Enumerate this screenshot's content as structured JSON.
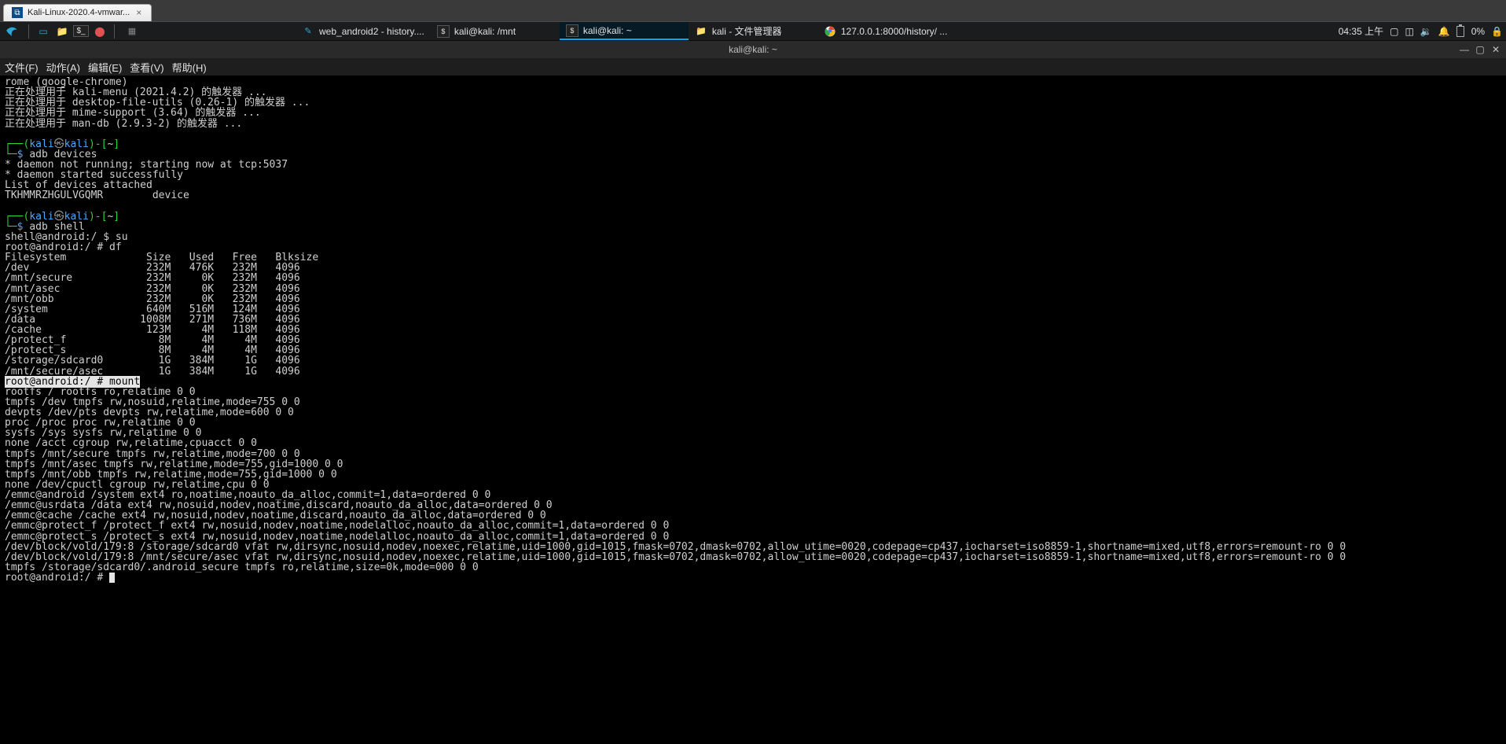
{
  "host_tab": {
    "label": "Kali-Linux-2020.4-vmwar...",
    "close": "×"
  },
  "panel": {
    "tasks": [
      {
        "icon": "☵",
        "label": ""
      },
      {
        "icon": "🗔",
        "label": "web_android2 - history...."
      },
      {
        "icon": "$",
        "label": "kali@kali: /mnt"
      },
      {
        "icon": "$",
        "label": "kali@kali: ~",
        "active": true
      },
      {
        "icon": "📁",
        "label": "kali - 文件管理器"
      },
      {
        "icon": "◎",
        "label": "127.0.0.1:8000/history/ ..."
      }
    ],
    "clock": "04:35 上午",
    "battery": "0%"
  },
  "terminal": {
    "title": "kali@kali: ~",
    "menus": [
      "文件(F)",
      "动作(A)",
      "编辑(E)",
      "查看(V)",
      "帮助(H)"
    ]
  },
  "term_output": {
    "pre1": "rome (google-chrome)\n正在处理用于 kali-menu (2021.4.2) 的触发器 ...\n正在处理用于 desktop-file-utils (0.26-1) 的触发器 ...\n正在处理用于 mime-support (3.64) 的触发器 ...\n正在处理用于 man-db (2.9.3-2) 的触发器 ...",
    "prompt1_cmd": "adb devices",
    "out1": "* daemon not running; starting now at tcp:5037\n* daemon started successfully\nList of devices attached\nTKHMMRZHGULVGQMR\tdevice\n",
    "prompt2_cmd": "adb shell",
    "out2a": "shell@android:/ $ su\nroot@android:/ # df",
    "df": "Filesystem             Size   Used   Free   Blksize\n/dev                   232M   476K   232M   4096\n/mnt/secure            232M     0K   232M   4096\n/mnt/asec              232M     0K   232M   4096\n/mnt/obb               232M     0K   232M   4096\n/system                640M   516M   124M   4096\n/data                 1008M   271M   736M   4096\n/cache                 123M     4M   118M   4096\n/protect_f               8M     4M     4M   4096\n/protect_s               8M     4M     4M   4096\n/storage/sdcard0         1G   384M     1G   4096\n/mnt/secure/asec         1G   384M     1G   4096",
    "mount_prompt": "root@android:/ # mount",
    "mount": "rootfs / rootfs ro,relatime 0 0\ntmpfs /dev tmpfs rw,nosuid,relatime,mode=755 0 0\ndevpts /dev/pts devpts rw,relatime,mode=600 0 0\nproc /proc proc rw,relatime 0 0\nsysfs /sys sysfs rw,relatime 0 0\nnone /acct cgroup rw,relatime,cpuacct 0 0\ntmpfs /mnt/secure tmpfs rw,relatime,mode=700 0 0\ntmpfs /mnt/asec tmpfs rw,relatime,mode=755,gid=1000 0 0\ntmpfs /mnt/obb tmpfs rw,relatime,mode=755,gid=1000 0 0\nnone /dev/cpuctl cgroup rw,relatime,cpu 0 0\n/emmc@android /system ext4 ro,noatime,noauto_da_alloc,commit=1,data=ordered 0 0\n/emmc@usrdata /data ext4 rw,nosuid,nodev,noatime,discard,noauto_da_alloc,data=ordered 0 0\n/emmc@cache /cache ext4 rw,nosuid,nodev,noatime,discard,noauto_da_alloc,data=ordered 0 0\n/emmc@protect_f /protect_f ext4 rw,nosuid,nodev,noatime,nodelalloc,noauto_da_alloc,commit=1,data=ordered 0 0\n/emmc@protect_s /protect_s ext4 rw,nosuid,nodev,noatime,nodelalloc,noauto_da_alloc,commit=1,data=ordered 0 0\n/dev/block/vold/179:8 /storage/sdcard0 vfat rw,dirsync,nosuid,nodev,noexec,relatime,uid=1000,gid=1015,fmask=0702,dmask=0702,allow_utime=0020,codepage=cp437,iocharset=iso8859-1,shortname=mixed,utf8,errors=remount-ro 0 0\n/dev/block/vold/179:8 /mnt/secure/asec vfat rw,dirsync,nosuid,nodev,noexec,relatime,uid=1000,gid=1015,fmask=0702,dmask=0702,allow_utime=0020,codepage=cp437,iocharset=iso8859-1,shortname=mixed,utf8,errors=remount-ro 0 0\ntmpfs /storage/sdcard0/.android_secure tmpfs ro,relatime,size=0k,mode=000 0 0",
    "end_prompt": "root@android:/ # "
  },
  "prompt_parts": {
    "lparen": "(",
    "user": "kali",
    "at": "㉿",
    "host": "kali",
    "rparen": ")-[",
    "cwd": "~",
    "rbrack": "]",
    "dollar": "$"
  }
}
